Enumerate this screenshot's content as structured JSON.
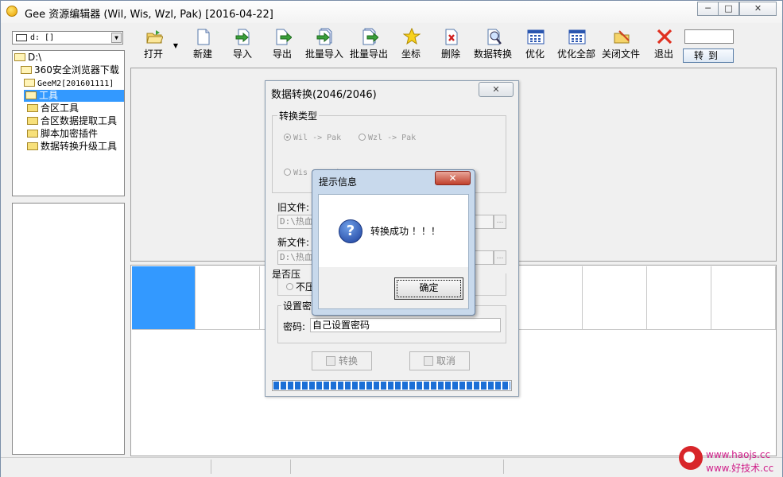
{
  "window": {
    "title": "Gee 资源编辑器 (Wil, Wis, Wzl, Pak) [2016-04-22]",
    "controls": {
      "minimize": "─",
      "maximize": "□",
      "close": "✕"
    }
  },
  "sidebar": {
    "drive_value": "d: []",
    "tree": [
      {
        "label": "D:\\"
      },
      {
        "label": "360安全浏览器下载"
      },
      {
        "label": "GeeM2[201601111]"
      },
      {
        "label": "工具"
      },
      {
        "label": "合区工具"
      },
      {
        "label": "合区数据提取工具"
      },
      {
        "label": "脚本加密插件"
      },
      {
        "label": "数据转换升级工具"
      }
    ]
  },
  "toolbar": {
    "buttons": [
      {
        "label": "打开",
        "icon": "open-folder-icon"
      },
      {
        "label": "新建",
        "icon": "new-file-icon"
      },
      {
        "label": "导入",
        "icon": "import-icon"
      },
      {
        "label": "导出",
        "icon": "export-icon"
      },
      {
        "label": "批量导入",
        "icon": "batch-import-icon"
      },
      {
        "label": "批量导出",
        "icon": "batch-export-icon"
      },
      {
        "label": "坐标",
        "icon": "star-icon"
      },
      {
        "label": "删除",
        "icon": "delete-icon"
      },
      {
        "label": "数据转换",
        "icon": "convert-icon"
      },
      {
        "label": "优化",
        "icon": "optimize-icon"
      },
      {
        "label": "优化全部",
        "icon": "optimize-all-icon"
      },
      {
        "label": "关闭文件",
        "icon": "close-file-icon"
      },
      {
        "label": "退出",
        "icon": "exit-icon"
      }
    ],
    "goto_label": "转到",
    "goto_value": ""
  },
  "convert_dialog": {
    "title": "数据转换(2046/2046)",
    "close": "✕",
    "type_group": "转换类型",
    "options": [
      {
        "label": "Wil -> Pak",
        "checked": true
      },
      {
        "label": "Wzl -> Pak",
        "checked": false
      },
      {
        "label": "Wis -> Pak",
        "checked": false
      }
    ],
    "old_file_label": "旧文件:",
    "old_file_value": "D:\\热血",
    "new_file_label": "新文件:",
    "new_file_value": "D:\\热血",
    "browse": "...",
    "compress_group": "是否压",
    "compress_option": "不压",
    "password_group": "设置密",
    "password_label": "密码:",
    "password_value": "自己设置密码",
    "convert_button": "转换",
    "cancel_button": "取消",
    "progress": 1.0
  },
  "message_box": {
    "title": "提示信息",
    "close": "✕",
    "icon": "question-icon",
    "text": "转换成功 ！！！",
    "ok_button": "确定"
  },
  "watermark": {
    "line1": "www.haojs.cc",
    "line2": "www.好技术.cc"
  },
  "colors": {
    "selection": "#3399ff",
    "progress": "#1c6fd6",
    "close_red": "#c0402c",
    "watermark": "#d0208a"
  }
}
